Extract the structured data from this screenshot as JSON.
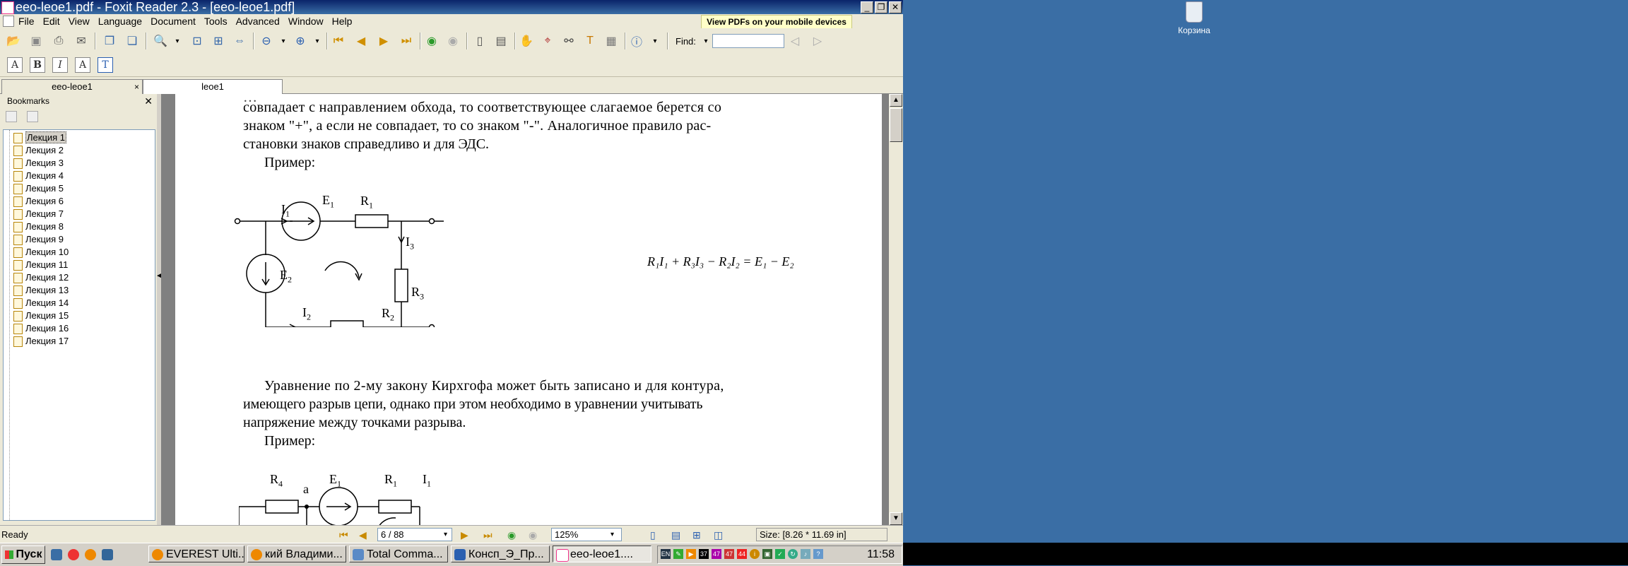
{
  "window": {
    "title": "eeo-leoe1.pdf - Foxit Reader 2.3 - [eeo-leoe1.pdf]",
    "min": "_",
    "max": "❐",
    "close": "✕"
  },
  "menu": [
    "File",
    "Edit",
    "View",
    "Language",
    "Document",
    "Tools",
    "Advanced",
    "Window",
    "Help"
  ],
  "promo": "View PDFs on your mobile devices",
  "find": {
    "label": "Find:",
    "value": ""
  },
  "format_tools": [
    "A",
    "B",
    "I",
    "A",
    "T"
  ],
  "tabs": [
    {
      "label": "eeo-leoe1",
      "close": "×"
    },
    {
      "label": "leoe1"
    }
  ],
  "bookmarks": {
    "title": "Bookmarks",
    "close": "✕",
    "items": [
      "Лекция 1",
      "Лекция 2",
      "Лекция 3",
      "Лекция 4",
      "Лекция 5",
      "Лекция 6",
      "Лекция 7",
      "Лекция 8",
      "Лекция 9",
      "Лекция 10",
      "Лекция 11",
      "Лекция 12",
      "Лекция 13",
      "Лекция 14",
      "Лекция 15",
      "Лекция 16",
      "Лекция 17"
    ],
    "selected_index": 0
  },
  "document": {
    "para1": [
      "совпадает с направлением обхода, то соответствующее слагаемое берется со",
      "знаком \"+\",  а если не совпадает, то со знаком \"-\". Аналогичное правило рас-",
      "становки знаков справедливо и для ЭДС."
    ],
    "example": "Пример:",
    "circuit1": {
      "I1": "I",
      "I1s": "1",
      "E1": "E",
      "E1s": "1",
      "R1": "R",
      "R1s": "1",
      "I3": "I",
      "I3s": "3",
      "E2": "E",
      "E2s": "2",
      "R3": "R",
      "R3s": "3",
      "I2": "I",
      "I2s": "2",
      "R2": "R",
      "R2s": "2"
    },
    "equation": "R₁I₁ + R₃I₃ − R₂I₂ = E₁ − E₂",
    "para2": [
      "Уравнение по  2-му закону Кирхгофа может быть записано и для контура,",
      "имеющего разрыв цепи,  однако при этом  необходимо  в  уравнении учитывать",
      "напряжение между точками разрыва."
    ],
    "example2": "Пример:",
    "circuit2": {
      "R4": "R",
      "R4s": "4",
      "a": "a",
      "E1": "E",
      "E1s": "1",
      "R1": "R",
      "R1s": "1",
      "I1": "I",
      "I1s": "1"
    }
  },
  "status": {
    "ready": "Ready",
    "page": "6 / 88",
    "zoom": "125%",
    "size": "Size: [8.26 * 11.69 in]"
  },
  "desktop": {
    "recycle_label": "Корзина"
  },
  "taskbar": {
    "start": "Пуск",
    "tasks": [
      "EVEREST Ulti...",
      "кий Владими...",
      "Total Comma...",
      "Консп_Э_Пр...",
      "eeo-leoe1...."
    ],
    "tray_numbers": [
      "37",
      "47",
      "47",
      "44"
    ],
    "clock": "11:58"
  }
}
